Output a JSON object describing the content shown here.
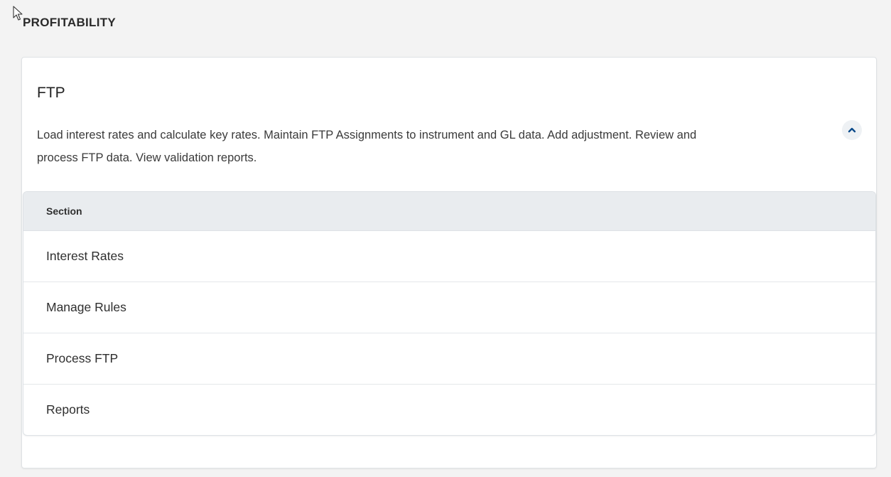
{
  "header": {
    "section_title": "PROFITABILITY"
  },
  "card": {
    "title": "FTP",
    "description": "Load interest rates and calculate key rates. Maintain FTP Assignments to instrument and GL data. Add adjustment. Review and process FTP data. View validation reports.",
    "collapse_icon": "chevron-up-icon",
    "accent_color": "#0a4a8a"
  },
  "table": {
    "column_header": "Section",
    "rows": [
      {
        "label": "Interest Rates"
      },
      {
        "label": "Manage Rules"
      },
      {
        "label": "Process FTP"
      },
      {
        "label": "Reports"
      }
    ]
  }
}
